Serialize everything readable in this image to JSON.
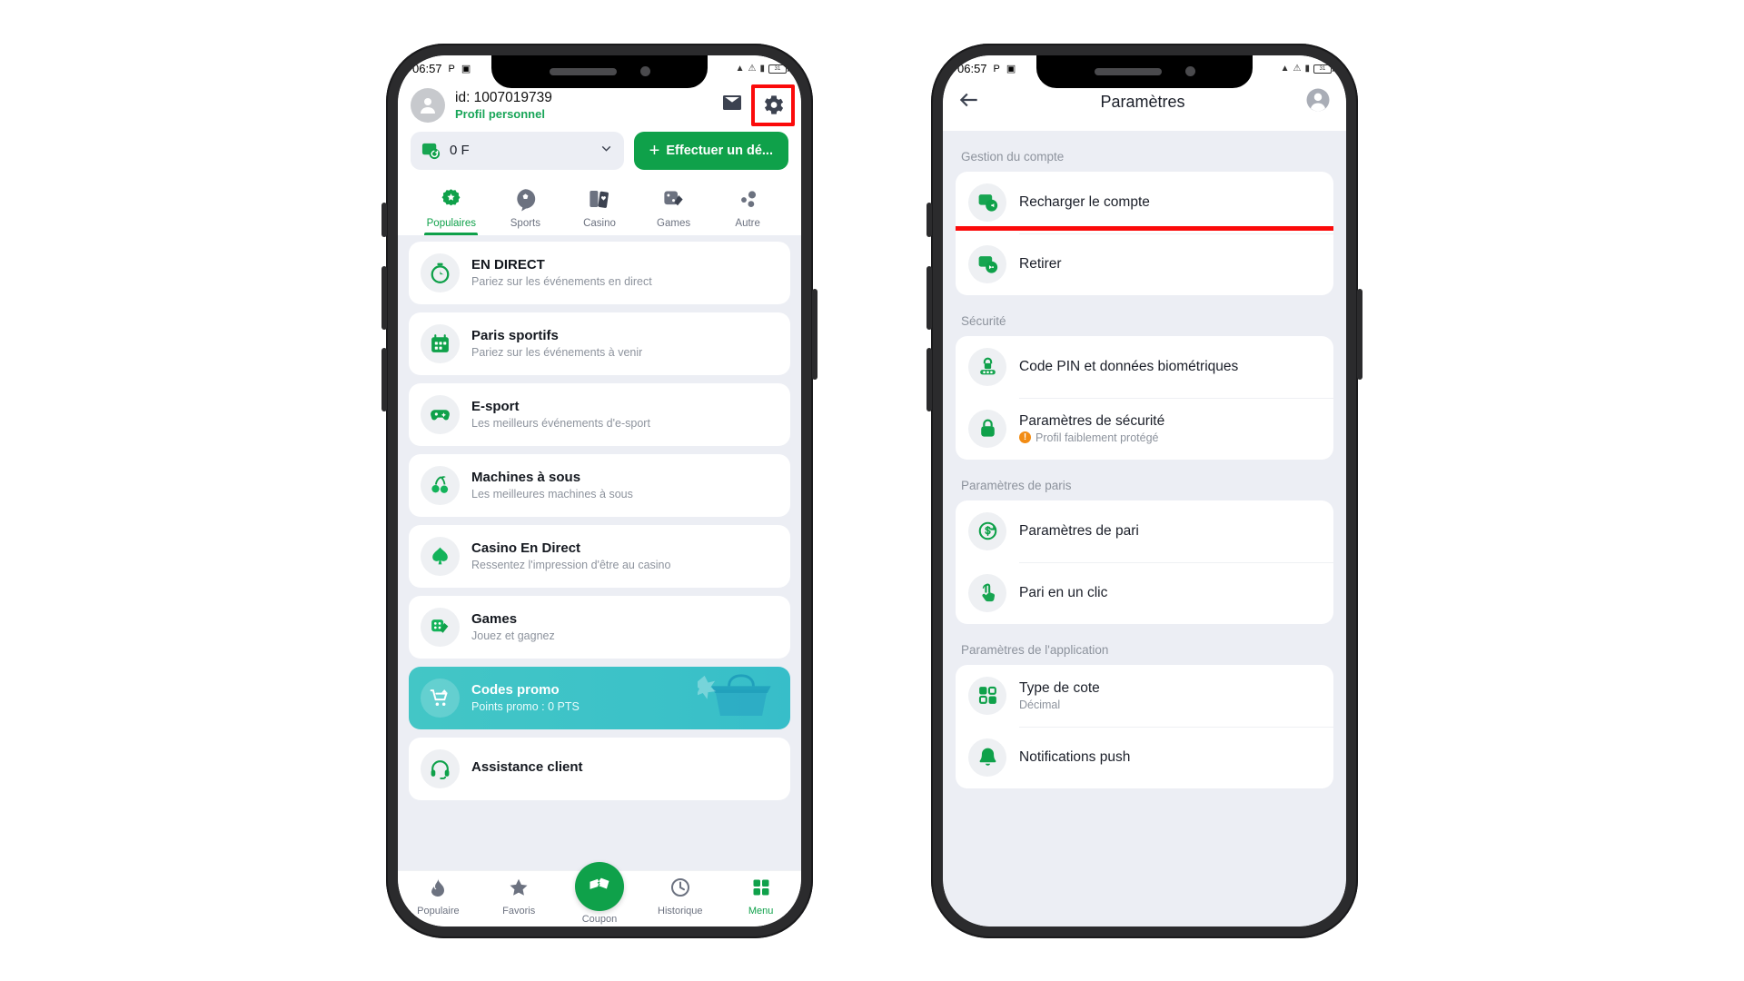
{
  "status_bar": {
    "time": "06:57",
    "p_icon": "P",
    "cast_icon": "screen-cast",
    "wifi": "wifi-icon",
    "signal": "signal-icon",
    "battery": "31"
  },
  "left_phone": {
    "profile": {
      "id": "id: 1007019739",
      "subtitle": "Profil personnel",
      "avatar_icon": "person-icon"
    },
    "header_icons": {
      "mail": "mail-icon",
      "gear": "gear-icon"
    },
    "balance": {
      "amount": "0 F",
      "wallet_icon": "wallet-icon",
      "chevron": "chevron-down-icon"
    },
    "deposit_button": {
      "label": "Effectuer un dé...",
      "plus": "+"
    },
    "tabs": [
      {
        "label": "Populaires",
        "icon": "star-gear-icon",
        "active": true
      },
      {
        "label": "Sports",
        "icon": "football-icon",
        "active": false
      },
      {
        "label": "Casino",
        "icon": "cards-icon",
        "active": false
      },
      {
        "label": "Games",
        "icon": "dice-icon",
        "active": false
      },
      {
        "label": "Autre",
        "icon": "dots-icon",
        "active": false
      }
    ],
    "cards": [
      {
        "title": "EN DIRECT",
        "subtitle": "Pariez sur les événements en direct",
        "icon": "stopwatch-icon",
        "promo": false
      },
      {
        "title": "Paris sportifs",
        "subtitle": "Pariez sur les événements à venir",
        "icon": "calendar-icon",
        "promo": false
      },
      {
        "title": "E-sport",
        "subtitle": "Les meilleurs événements d'e-sport",
        "icon": "gamepad-icon",
        "promo": false
      },
      {
        "title": "Machines à sous",
        "subtitle": "Les meilleures machines à sous",
        "icon": "cherry-icon",
        "promo": false
      },
      {
        "title": "Casino En Direct",
        "subtitle": "Ressentez l'impression d'être au casino",
        "icon": "spade-icon",
        "promo": false
      },
      {
        "title": "Games",
        "subtitle": "Jouez et gagnez",
        "icon": "dice-cards-icon",
        "promo": false
      },
      {
        "title": "Codes promo",
        "subtitle": "Points promo : 0 PTS",
        "icon": "cart-icon",
        "promo": true
      },
      {
        "title": "Assistance client",
        "subtitle": "",
        "icon": "headset-icon",
        "promo": false
      }
    ],
    "bottom_nav": [
      {
        "label": "Populaire",
        "icon": "fire-icon",
        "active": false
      },
      {
        "label": "Favoris",
        "icon": "star-icon",
        "active": false
      },
      {
        "label": "Coupon",
        "icon": "ticket-icon",
        "active": false,
        "fab": true
      },
      {
        "label": "Historique",
        "icon": "clock-icon",
        "active": false
      },
      {
        "label": "Menu",
        "icon": "grid-icon",
        "active": true
      }
    ]
  },
  "right_phone": {
    "header": {
      "title": "Paramètres",
      "back_icon": "arrow-left-icon",
      "account_icon": "account-circle-icon"
    },
    "sections": [
      {
        "label": "Gestion du compte",
        "rows": [
          {
            "title": "Recharger le compte",
            "subtitle": "",
            "icon": "wallet-refill-icon",
            "highlighted": false
          },
          {
            "title": "Retirer",
            "subtitle": "",
            "icon": "wallet-withdraw-icon",
            "highlighted": true
          }
        ]
      },
      {
        "label": "Sécurité",
        "rows": [
          {
            "title": "Code PIN et données biométriques",
            "subtitle": "",
            "icon": "fingerprint-lock-icon",
            "highlighted": false
          },
          {
            "title": "Paramètres de sécurité",
            "subtitle": "Profil faiblement protégé",
            "warning": "!",
            "icon": "lock-icon",
            "highlighted": false
          }
        ]
      },
      {
        "label": "Paramètres de paris",
        "rows": [
          {
            "title": "Paramètres de pari",
            "subtitle": "",
            "icon": "dollar-refresh-icon",
            "highlighted": false
          },
          {
            "title": "Pari en un clic",
            "subtitle": "",
            "icon": "tap-hand-icon",
            "highlighted": false
          }
        ]
      },
      {
        "label": "Paramètres de l'application",
        "rows": [
          {
            "title": "Type de cote",
            "subtitle": "Décimal",
            "icon": "grid-four-icon",
            "highlighted": false
          },
          {
            "title": "Notifications push",
            "subtitle": "",
            "icon": "bell-icon",
            "highlighted": false
          }
        ]
      }
    ]
  },
  "colors": {
    "brand_green": "#0fa14a",
    "highlight_red": "#fb0a0a",
    "promo_teal": "#3cc2c8",
    "bg": "#eceef4",
    "warning_orange": "#f28c14"
  }
}
